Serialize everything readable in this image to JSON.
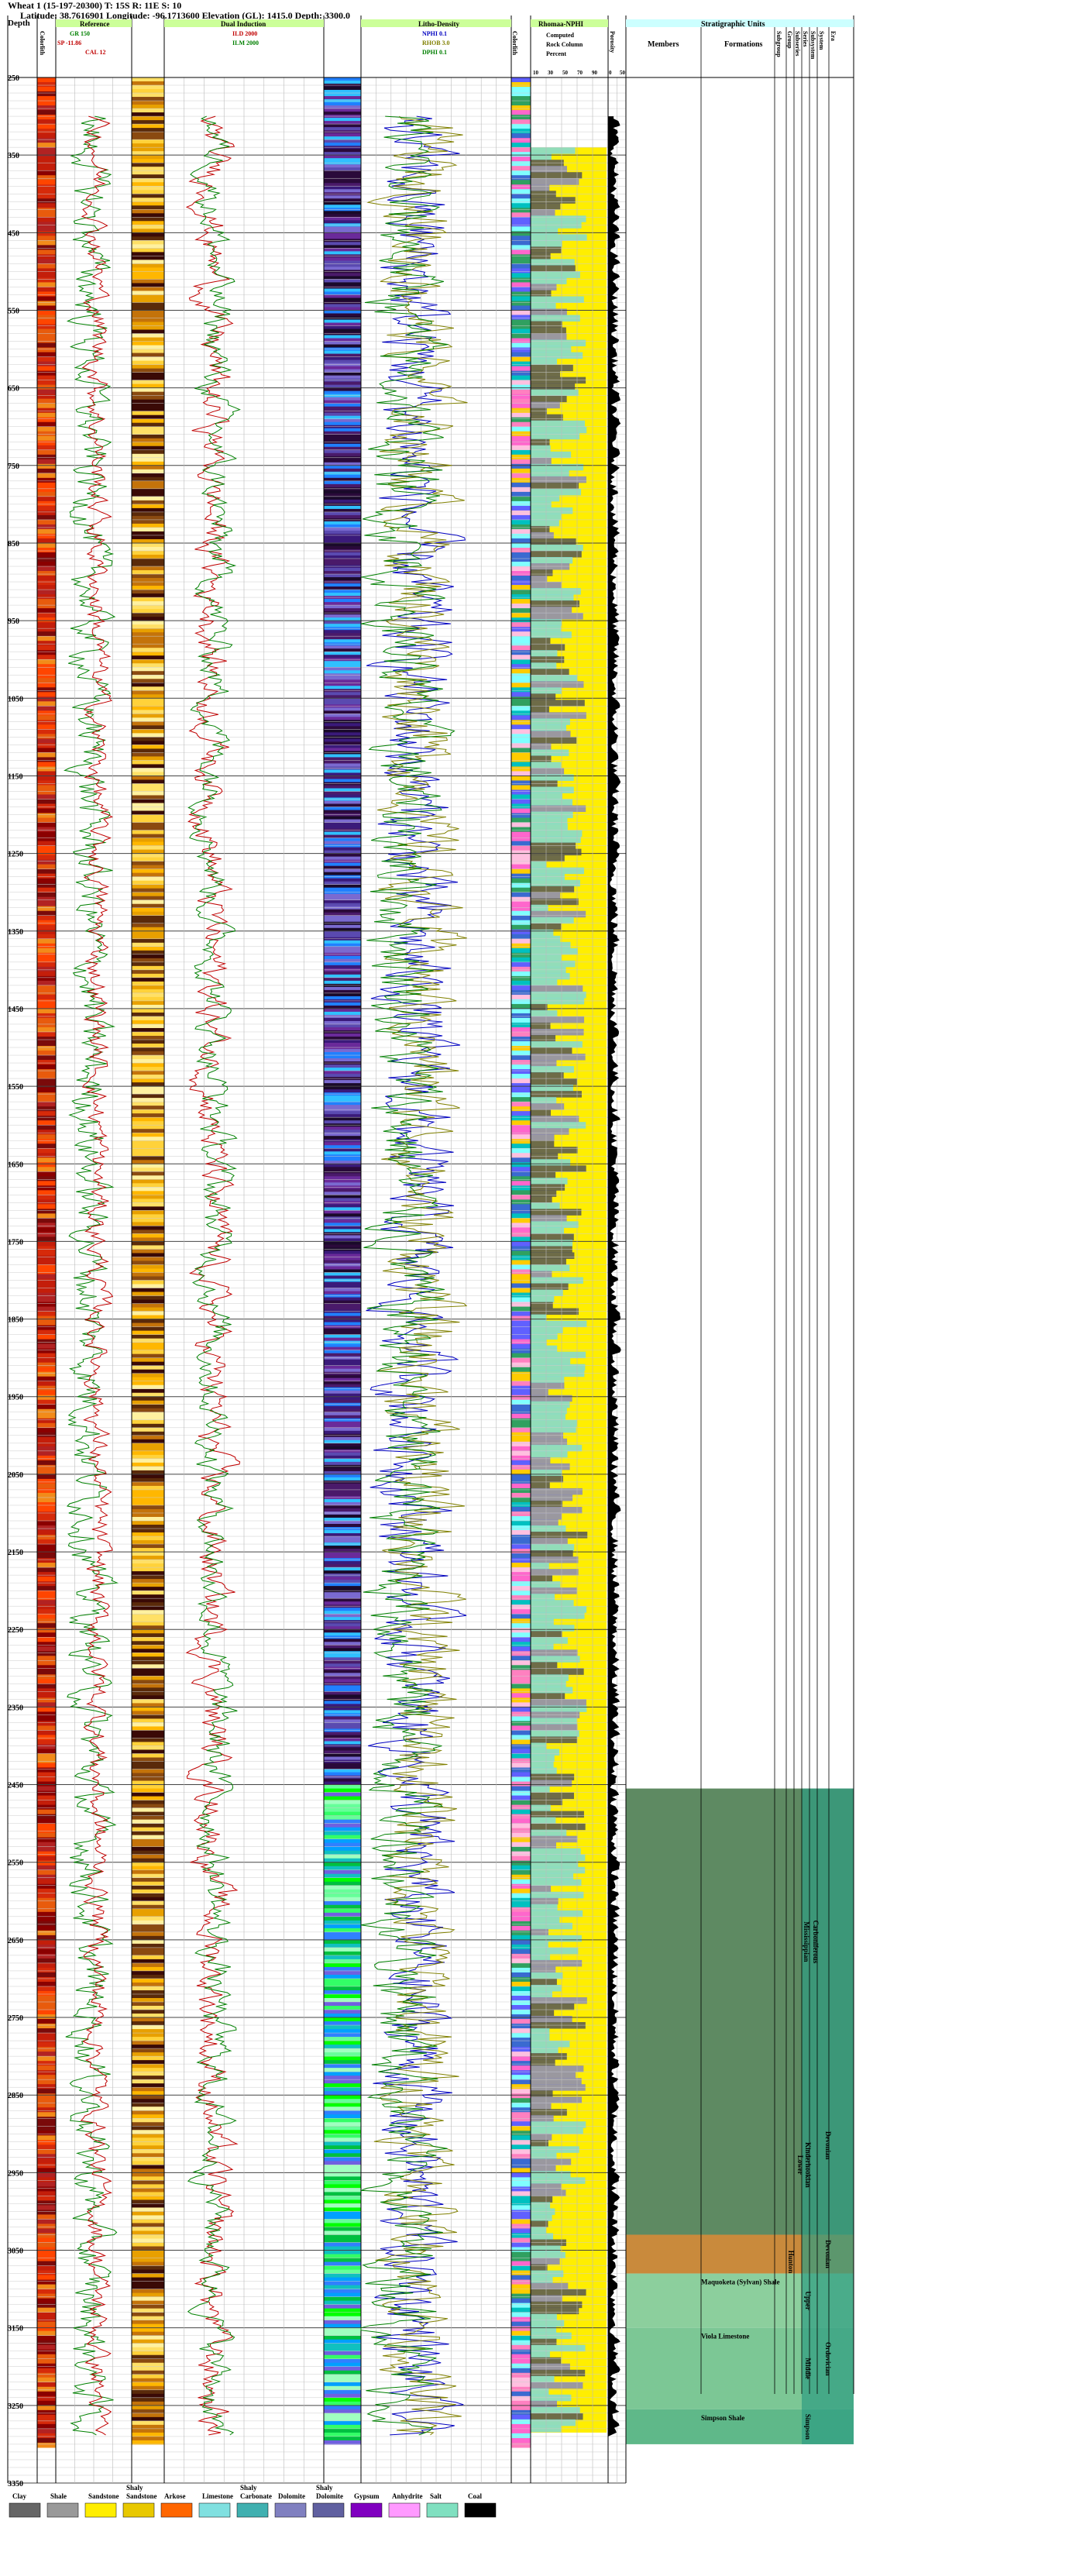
{
  "header": {
    "line1": "Wheat 1 (15-197-20300) T: 15S R: 11E S: 10",
    "line2": "Latitude: 38.7616901 Longitude: -96.1713600 Elevation (GL): 1415.0 Depth: 3300.0"
  },
  "columns": {
    "depth": "Depth",
    "color_lith": "Colorlith",
    "reference": "Reference",
    "dual_induction": "Dual Induction",
    "litho_density": "Litho-Density",
    "rhomaa_nphi": "Rhomaa-NPHI",
    "porosity": "Porosity",
    "strat_units": "Stratigraphic Units",
    "members": "Members",
    "formations": "Formations",
    "subgroup": "Subgroup",
    "group": "Group",
    "subseries": "Subseries",
    "series": "Series",
    "subsystem": "Subsystem",
    "system": "System",
    "era": "Era"
  },
  "curves": {
    "gr": {
      "name": "GR",
      "min": "0",
      "max": "150",
      "unit": "0"
    },
    "sp": {
      "name": "SP",
      "min": "-191.507",
      "max": "-11.86"
    },
    "cal": {
      "name": "CAL",
      "min": "6",
      "max": "12"
    },
    "ild": {
      "name": "ILD",
      "min": "0.1",
      "max": "2000"
    },
    "ilm": {
      "name": "ILM",
      "min": "0.1",
      "max": "2000"
    },
    "nphi": {
      "name": "NPHI",
      "min": "0.3",
      "max": "0.1"
    },
    "rhob": {
      "name": "RHOB",
      "min": "2.0",
      "max": "3.0"
    },
    "dphi": {
      "name": "DPHI",
      "min": "0.3",
      "max": "0.1"
    },
    "rock_column": [
      "Computed",
      "Rock Column",
      "Percent"
    ],
    "percent_ticks": [
      "10",
      "30",
      "50",
      "70",
      "90"
    ],
    "porosity_ticks": [
      "0",
      "50"
    ]
  },
  "depth_axis": {
    "start": 250,
    "end": 3350,
    "step": 100,
    "labels": [
      "250",
      "350",
      "450",
      "550",
      "650",
      "750",
      "850",
      "950",
      "1050",
      "1150",
      "1250",
      "1350",
      "1450",
      "1550",
      "1650",
      "1750",
      "1850",
      "1950",
      "2050",
      "2150",
      "2250",
      "2350",
      "2450",
      "2550",
      "2650",
      "2750",
      "2850",
      "2950",
      "3050",
      "3150",
      "3250",
      "3350"
    ]
  },
  "strat": {
    "formations": [
      {
        "name": "Maquoketa (Sylvan) Shale",
        "top": 3080,
        "base": 3150
      },
      {
        "name": "Viola Limestone",
        "top": 3150,
        "base": 3255
      },
      {
        "name": "Simpson Shale",
        "top": 3255,
        "base": 3275
      }
    ],
    "groups": [
      {
        "name": "Hunton",
        "top": 3030,
        "base": 3100
      }
    ],
    "series": [
      {
        "name": "Kinderhookian",
        "top": 2850,
        "base": 3030
      },
      {
        "name": "Upper",
        "top": 3080,
        "base": 3150
      },
      {
        "name": "Middle",
        "top": 3150,
        "base": 3255
      },
      {
        "name": "Simpson",
        "top": 3255,
        "base": 3300
      }
    ],
    "subseries": [
      {
        "name": "Lower",
        "top": 2850,
        "base": 3030
      }
    ],
    "subsystem": [
      {
        "name": "Carboniferous",
        "top": 2455,
        "base": 2850
      },
      {
        "name": "Mississippian",
        "top": 2455,
        "base": 2850
      }
    ],
    "system": [
      {
        "name": "Devonian",
        "top": 2800,
        "base": 3030
      },
      {
        "name": "Devonian",
        "top": 3030,
        "base": 3080
      },
      {
        "name": "Ordovician",
        "top": 3080,
        "base": 3300
      }
    ]
  },
  "legend": [
    {
      "label": "Clay",
      "pattern": "clay"
    },
    {
      "label": "Shale",
      "pattern": "shale"
    },
    {
      "label": "Sandstone",
      "pattern": "sandstone"
    },
    {
      "label": "Shaly Sandstone",
      "pattern": "shaly-sandstone"
    },
    {
      "label": "Arkose",
      "pattern": "arkose"
    },
    {
      "label": "Limestone",
      "pattern": "limestone"
    },
    {
      "label": "Shaly Carbonate",
      "pattern": "shaly-carbonate"
    },
    {
      "label": "Dolomite",
      "pattern": "dolomite"
    },
    {
      "label": "Shaly Dolomite",
      "pattern": "shaly-dolomite"
    },
    {
      "label": "Gypsum",
      "pattern": "gypsum"
    },
    {
      "label": "Anhydrite",
      "pattern": "anhydrite"
    },
    {
      "label": "Salt",
      "pattern": "salt"
    },
    {
      "label": "Coal",
      "pattern": "coal"
    }
  ],
  "colors": {
    "gr": "#008000",
    "sp": "#c00000",
    "cal": "#c00000",
    "ild": "#c00000",
    "ilm": "#008000",
    "nphi": "#0000c0",
    "rhob": "#808000",
    "dphi": "#008000",
    "strat_green": "#5e8a62",
    "strat_orange": "#c98a3c",
    "strat_lightgreen": "#8ccf9d",
    "strat_teal": "#2e9c82",
    "header_green": "#ccff99",
    "header_cyan": "#ccffff"
  }
}
